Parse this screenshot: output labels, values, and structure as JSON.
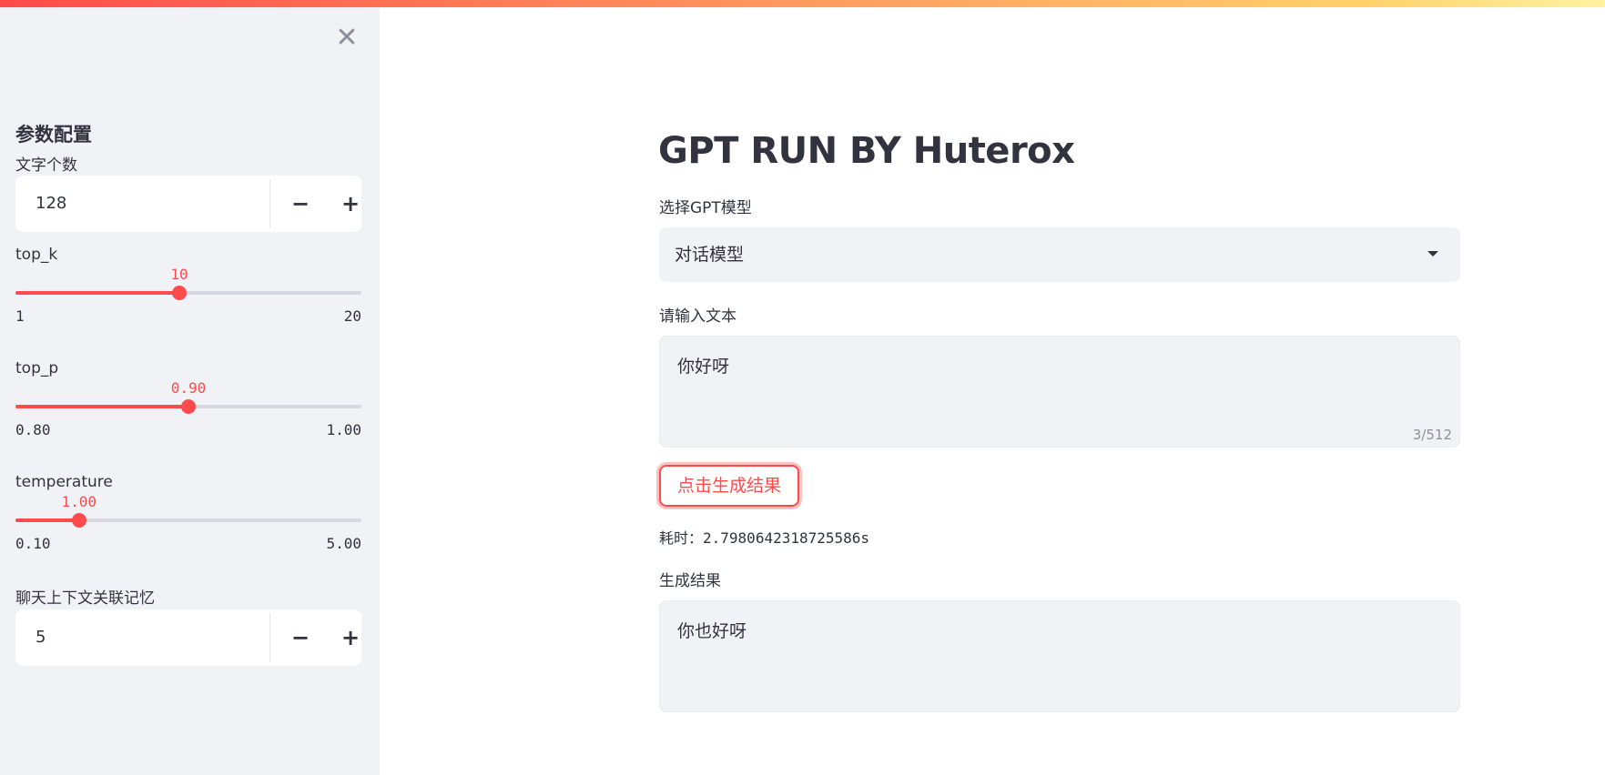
{
  "sidebar": {
    "close_icon_glyph": "✕",
    "heading": "参数配置",
    "length": {
      "label": "文字个数",
      "value": "128",
      "minus": "−",
      "plus": "+"
    },
    "top_k": {
      "label": "top_k",
      "value": 10,
      "value_text": "10",
      "min": 1,
      "max": 20,
      "min_text": "1",
      "max_text": "20"
    },
    "top_p": {
      "label": "top_p",
      "value": 0.9,
      "value_text": "0.90",
      "min": 0.8,
      "max": 1.0,
      "min_text": "0.80",
      "max_text": "1.00"
    },
    "temperature": {
      "label": "temperature",
      "value": 1.0,
      "value_text": "1.00",
      "min": 0.1,
      "max": 5.0,
      "min_text": "0.10",
      "max_text": "5.00"
    },
    "memory": {
      "label": "聊天上下文关联记忆",
      "value": "5",
      "minus": "−",
      "plus": "+"
    }
  },
  "main": {
    "title": "GPT RUN BY Huterox",
    "model_select": {
      "label": "选择GPT模型",
      "value": "对话模型"
    },
    "input": {
      "label": "请输入文本",
      "value": "你好呀",
      "counter": "3/512"
    },
    "generate_button": "点击生成结果",
    "timing": {
      "label": "耗时：",
      "value": "2.7980642318725586s"
    },
    "output": {
      "label": "生成结果",
      "value": "你也好呀"
    }
  },
  "colors": {
    "accent": "#ff4b4b",
    "sidebar_bg": "#f0f2f6",
    "text": "#31333f"
  }
}
